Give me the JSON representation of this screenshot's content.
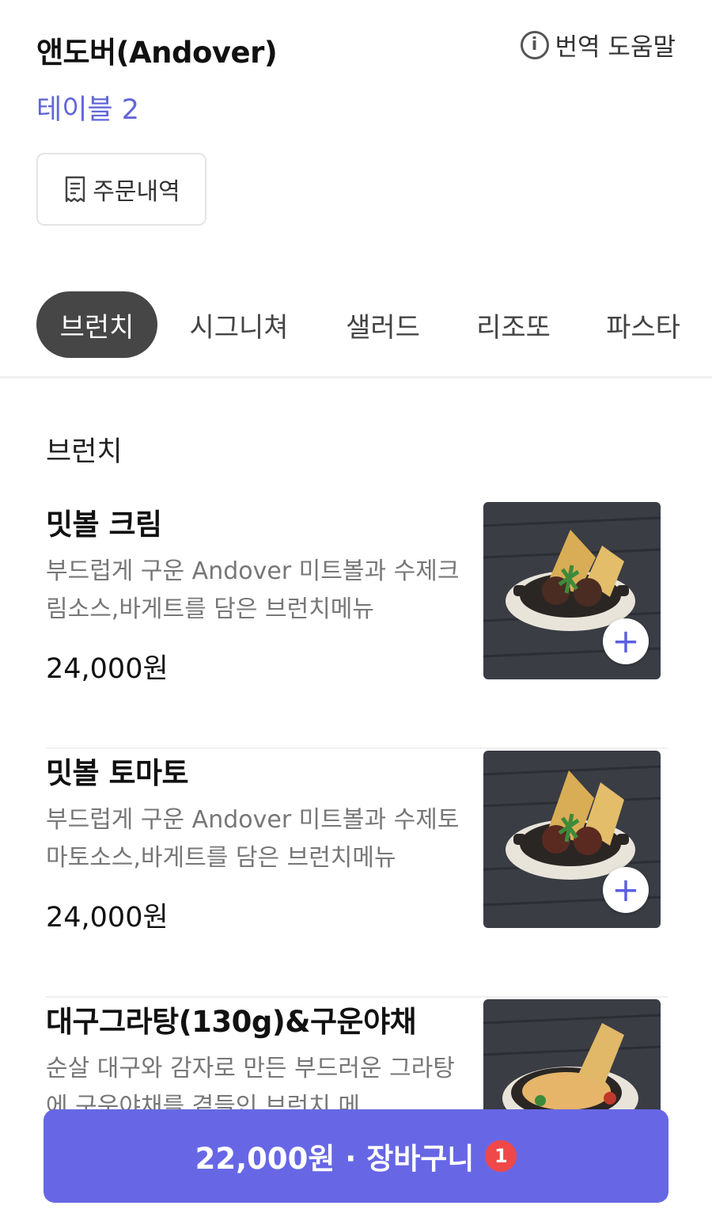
{
  "header": {
    "store_name": "앤도버(Andover)",
    "table_name": "테이블 2",
    "help_label": "번역 도움말",
    "order_history_label": "주문내역"
  },
  "tabs": [
    {
      "label": "브런치",
      "active": true
    },
    {
      "label": "시그니쳐",
      "active": false
    },
    {
      "label": "샐러드",
      "active": false
    },
    {
      "label": "리조또",
      "active": false
    },
    {
      "label": "파스타",
      "active": false
    }
  ],
  "section": {
    "title": "브런치"
  },
  "items": [
    {
      "name": "밋볼 크림",
      "description": "부드럽게 구운 Andover 미트볼과 수제크림소스,바게트를 담은 브런치메뉴",
      "price": "24,000원"
    },
    {
      "name": "밋볼 토마토",
      "description": "부드럽게 구운 Andover 미트볼과 수제토마토소스,바게트를 담은 브런치메뉴",
      "price": "24,000원"
    },
    {
      "name": "대구그라탕(130g)&구운야채",
      "description": "순살 대구와 감자로 만든 부드러운 그라탕에 구운야채를 곁들인 브런치 메",
      "price": ""
    }
  ],
  "cart": {
    "label": "22,000원 · 장바구니",
    "count": "1"
  },
  "colors": {
    "accent": "#6767e6",
    "table_name": "#6266d8",
    "active_tab": "#464646",
    "badge": "#f04848"
  },
  "icons": {
    "help": "info-circle-icon",
    "order_history": "receipt-icon",
    "add": "plus-icon"
  }
}
